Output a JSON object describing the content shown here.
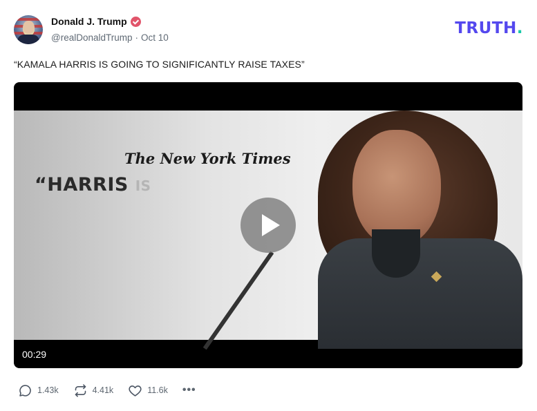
{
  "author": {
    "display_name": "Donald J. Trump",
    "handle": "@realDonaldTrump",
    "separator": "·",
    "date": "Oct 10"
  },
  "brand": {
    "logo_text": "TRUTH",
    "logo_dot": ".",
    "logo_color": "#5448ee",
    "dot_color": "#18c9a8"
  },
  "post": {
    "text": "“KAMALA HARRIS IS GOING TO SIGNIFICANTLY RAISE TAXES”"
  },
  "video": {
    "overlay_masthead": "The New York Times",
    "overlay_quote": "“HARRIS",
    "overlay_quote_tail": "IS",
    "duration": "00:29",
    "play_icon": "play-icon"
  },
  "actions": [
    {
      "icon": "reply-icon",
      "count": "1.43k"
    },
    {
      "icon": "retruth-icon",
      "count": "4.41k"
    },
    {
      "icon": "like-icon",
      "count": "11.6k"
    }
  ],
  "more_label": "•••"
}
